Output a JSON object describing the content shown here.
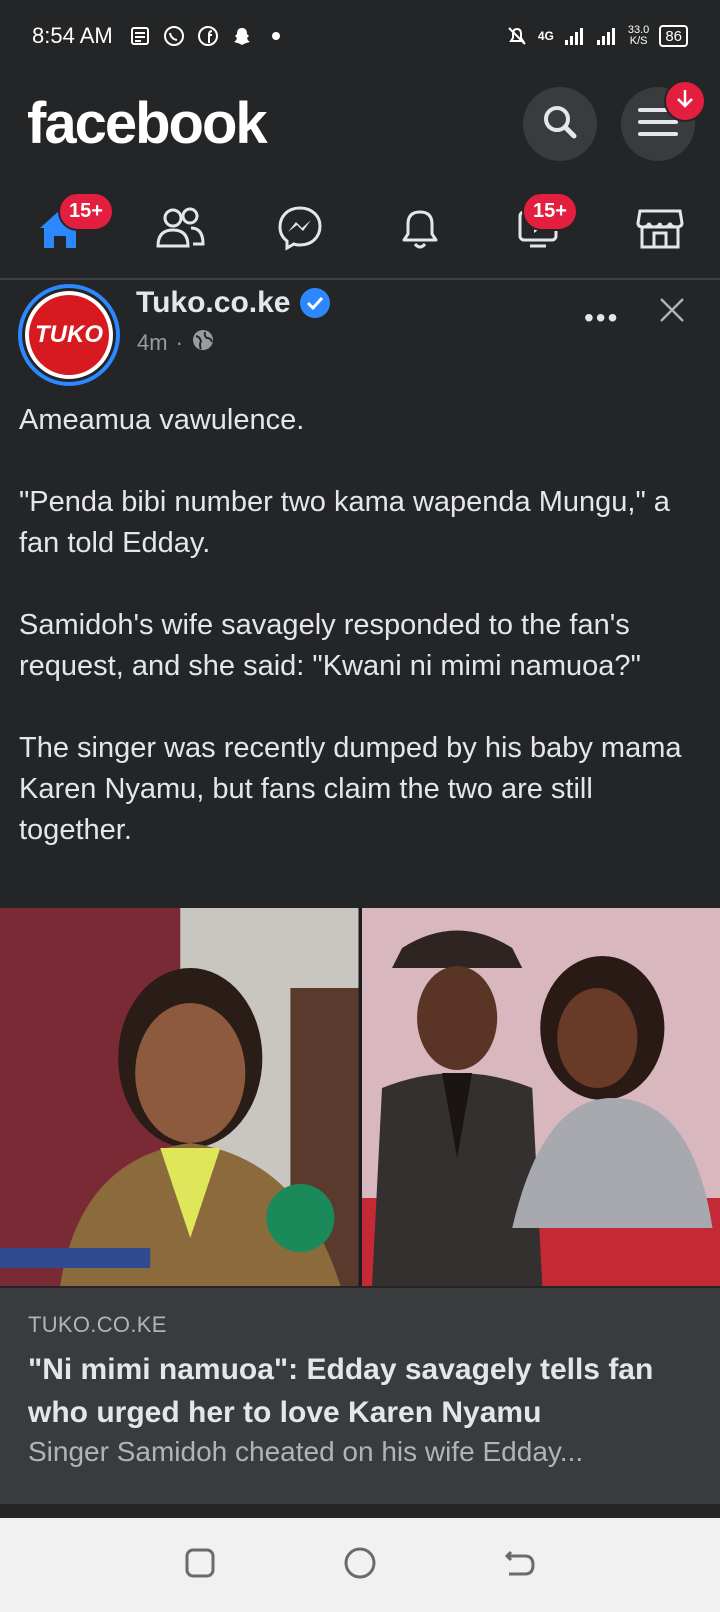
{
  "status_bar": {
    "time": "8:54 AM",
    "network_type": "4G",
    "speed_value": "33.0",
    "speed_unit": "K/S",
    "battery": "86"
  },
  "app": {
    "logo": "facebook",
    "menu_notification": "download"
  },
  "nav": {
    "home_badge": "15+",
    "watch_badge": "15+",
    "items": [
      "home",
      "friends",
      "messenger",
      "notifications",
      "watch",
      "marketplace"
    ]
  },
  "post": {
    "page_name": "Tuko.co.ke",
    "avatar_text": "TUKO",
    "time": "4m",
    "separator": "·",
    "more": "•••",
    "paragraphs": [
      "Ameamua vawulence.",
      "\"Penda bibi number two kama wapenda Mungu,\" a fan told Edday.",
      "Samidoh's wife savagely responded to the fan's request, and she said: \"Kwani ni mimi namuoa?\"",
      "The singer was recently dumped by his baby mama Karen Nyamu, but fans claim the two are still together."
    ],
    "link": {
      "domain": "TUKO.CO.KE",
      "headline": "\"Ni mimi namuoa\": Edday savagely tells fan who urged her to love Karen Nyamu",
      "snippet": "Singer Samidoh cheated on his wife Edday..."
    }
  },
  "colors": {
    "background": "#242526",
    "accent": "#2d88ff",
    "badge": "#e41e3f",
    "card": "#3a3b3c"
  }
}
